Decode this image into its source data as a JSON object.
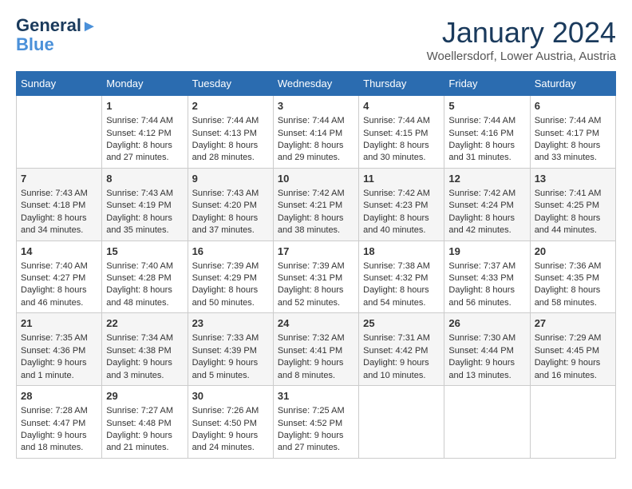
{
  "header": {
    "logo_line1": "General",
    "logo_line2": "Blue",
    "month": "January 2024",
    "location": "Woellersdorf, Lower Austria, Austria"
  },
  "weekdays": [
    "Sunday",
    "Monday",
    "Tuesday",
    "Wednesday",
    "Thursday",
    "Friday",
    "Saturday"
  ],
  "weeks": [
    [
      {
        "day": "",
        "sunrise": "",
        "sunset": "",
        "daylight": ""
      },
      {
        "day": "1",
        "sunrise": "Sunrise: 7:44 AM",
        "sunset": "Sunset: 4:12 PM",
        "daylight": "Daylight: 8 hours and 27 minutes."
      },
      {
        "day": "2",
        "sunrise": "Sunrise: 7:44 AM",
        "sunset": "Sunset: 4:13 PM",
        "daylight": "Daylight: 8 hours and 28 minutes."
      },
      {
        "day": "3",
        "sunrise": "Sunrise: 7:44 AM",
        "sunset": "Sunset: 4:14 PM",
        "daylight": "Daylight: 8 hours and 29 minutes."
      },
      {
        "day": "4",
        "sunrise": "Sunrise: 7:44 AM",
        "sunset": "Sunset: 4:15 PM",
        "daylight": "Daylight: 8 hours and 30 minutes."
      },
      {
        "day": "5",
        "sunrise": "Sunrise: 7:44 AM",
        "sunset": "Sunset: 4:16 PM",
        "daylight": "Daylight: 8 hours and 31 minutes."
      },
      {
        "day": "6",
        "sunrise": "Sunrise: 7:44 AM",
        "sunset": "Sunset: 4:17 PM",
        "daylight": "Daylight: 8 hours and 33 minutes."
      }
    ],
    [
      {
        "day": "7",
        "sunrise": "Sunrise: 7:43 AM",
        "sunset": "Sunset: 4:18 PM",
        "daylight": "Daylight: 8 hours and 34 minutes."
      },
      {
        "day": "8",
        "sunrise": "Sunrise: 7:43 AM",
        "sunset": "Sunset: 4:19 PM",
        "daylight": "Daylight: 8 hours and 35 minutes."
      },
      {
        "day": "9",
        "sunrise": "Sunrise: 7:43 AM",
        "sunset": "Sunset: 4:20 PM",
        "daylight": "Daylight: 8 hours and 37 minutes."
      },
      {
        "day": "10",
        "sunrise": "Sunrise: 7:42 AM",
        "sunset": "Sunset: 4:21 PM",
        "daylight": "Daylight: 8 hours and 38 minutes."
      },
      {
        "day": "11",
        "sunrise": "Sunrise: 7:42 AM",
        "sunset": "Sunset: 4:23 PM",
        "daylight": "Daylight: 8 hours and 40 minutes."
      },
      {
        "day": "12",
        "sunrise": "Sunrise: 7:42 AM",
        "sunset": "Sunset: 4:24 PM",
        "daylight": "Daylight: 8 hours and 42 minutes."
      },
      {
        "day": "13",
        "sunrise": "Sunrise: 7:41 AM",
        "sunset": "Sunset: 4:25 PM",
        "daylight": "Daylight: 8 hours and 44 minutes."
      }
    ],
    [
      {
        "day": "14",
        "sunrise": "Sunrise: 7:40 AM",
        "sunset": "Sunset: 4:27 PM",
        "daylight": "Daylight: 8 hours and 46 minutes."
      },
      {
        "day": "15",
        "sunrise": "Sunrise: 7:40 AM",
        "sunset": "Sunset: 4:28 PM",
        "daylight": "Daylight: 8 hours and 48 minutes."
      },
      {
        "day": "16",
        "sunrise": "Sunrise: 7:39 AM",
        "sunset": "Sunset: 4:29 PM",
        "daylight": "Daylight: 8 hours and 50 minutes."
      },
      {
        "day": "17",
        "sunrise": "Sunrise: 7:39 AM",
        "sunset": "Sunset: 4:31 PM",
        "daylight": "Daylight: 8 hours and 52 minutes."
      },
      {
        "day": "18",
        "sunrise": "Sunrise: 7:38 AM",
        "sunset": "Sunset: 4:32 PM",
        "daylight": "Daylight: 8 hours and 54 minutes."
      },
      {
        "day": "19",
        "sunrise": "Sunrise: 7:37 AM",
        "sunset": "Sunset: 4:33 PM",
        "daylight": "Daylight: 8 hours and 56 minutes."
      },
      {
        "day": "20",
        "sunrise": "Sunrise: 7:36 AM",
        "sunset": "Sunset: 4:35 PM",
        "daylight": "Daylight: 8 hours and 58 minutes."
      }
    ],
    [
      {
        "day": "21",
        "sunrise": "Sunrise: 7:35 AM",
        "sunset": "Sunset: 4:36 PM",
        "daylight": "Daylight: 9 hours and 1 minute."
      },
      {
        "day": "22",
        "sunrise": "Sunrise: 7:34 AM",
        "sunset": "Sunset: 4:38 PM",
        "daylight": "Daylight: 9 hours and 3 minutes."
      },
      {
        "day": "23",
        "sunrise": "Sunrise: 7:33 AM",
        "sunset": "Sunset: 4:39 PM",
        "daylight": "Daylight: 9 hours and 5 minutes."
      },
      {
        "day": "24",
        "sunrise": "Sunrise: 7:32 AM",
        "sunset": "Sunset: 4:41 PM",
        "daylight": "Daylight: 9 hours and 8 minutes."
      },
      {
        "day": "25",
        "sunrise": "Sunrise: 7:31 AM",
        "sunset": "Sunset: 4:42 PM",
        "daylight": "Daylight: 9 hours and 10 minutes."
      },
      {
        "day": "26",
        "sunrise": "Sunrise: 7:30 AM",
        "sunset": "Sunset: 4:44 PM",
        "daylight": "Daylight: 9 hours and 13 minutes."
      },
      {
        "day": "27",
        "sunrise": "Sunrise: 7:29 AM",
        "sunset": "Sunset: 4:45 PM",
        "daylight": "Daylight: 9 hours and 16 minutes."
      }
    ],
    [
      {
        "day": "28",
        "sunrise": "Sunrise: 7:28 AM",
        "sunset": "Sunset: 4:47 PM",
        "daylight": "Daylight: 9 hours and 18 minutes."
      },
      {
        "day": "29",
        "sunrise": "Sunrise: 7:27 AM",
        "sunset": "Sunset: 4:48 PM",
        "daylight": "Daylight: 9 hours and 21 minutes."
      },
      {
        "day": "30",
        "sunrise": "Sunrise: 7:26 AM",
        "sunset": "Sunset: 4:50 PM",
        "daylight": "Daylight: 9 hours and 24 minutes."
      },
      {
        "day": "31",
        "sunrise": "Sunrise: 7:25 AM",
        "sunset": "Sunset: 4:52 PM",
        "daylight": "Daylight: 9 hours and 27 minutes."
      },
      {
        "day": "",
        "sunrise": "",
        "sunset": "",
        "daylight": ""
      },
      {
        "day": "",
        "sunrise": "",
        "sunset": "",
        "daylight": ""
      },
      {
        "day": "",
        "sunrise": "",
        "sunset": "",
        "daylight": ""
      }
    ]
  ]
}
